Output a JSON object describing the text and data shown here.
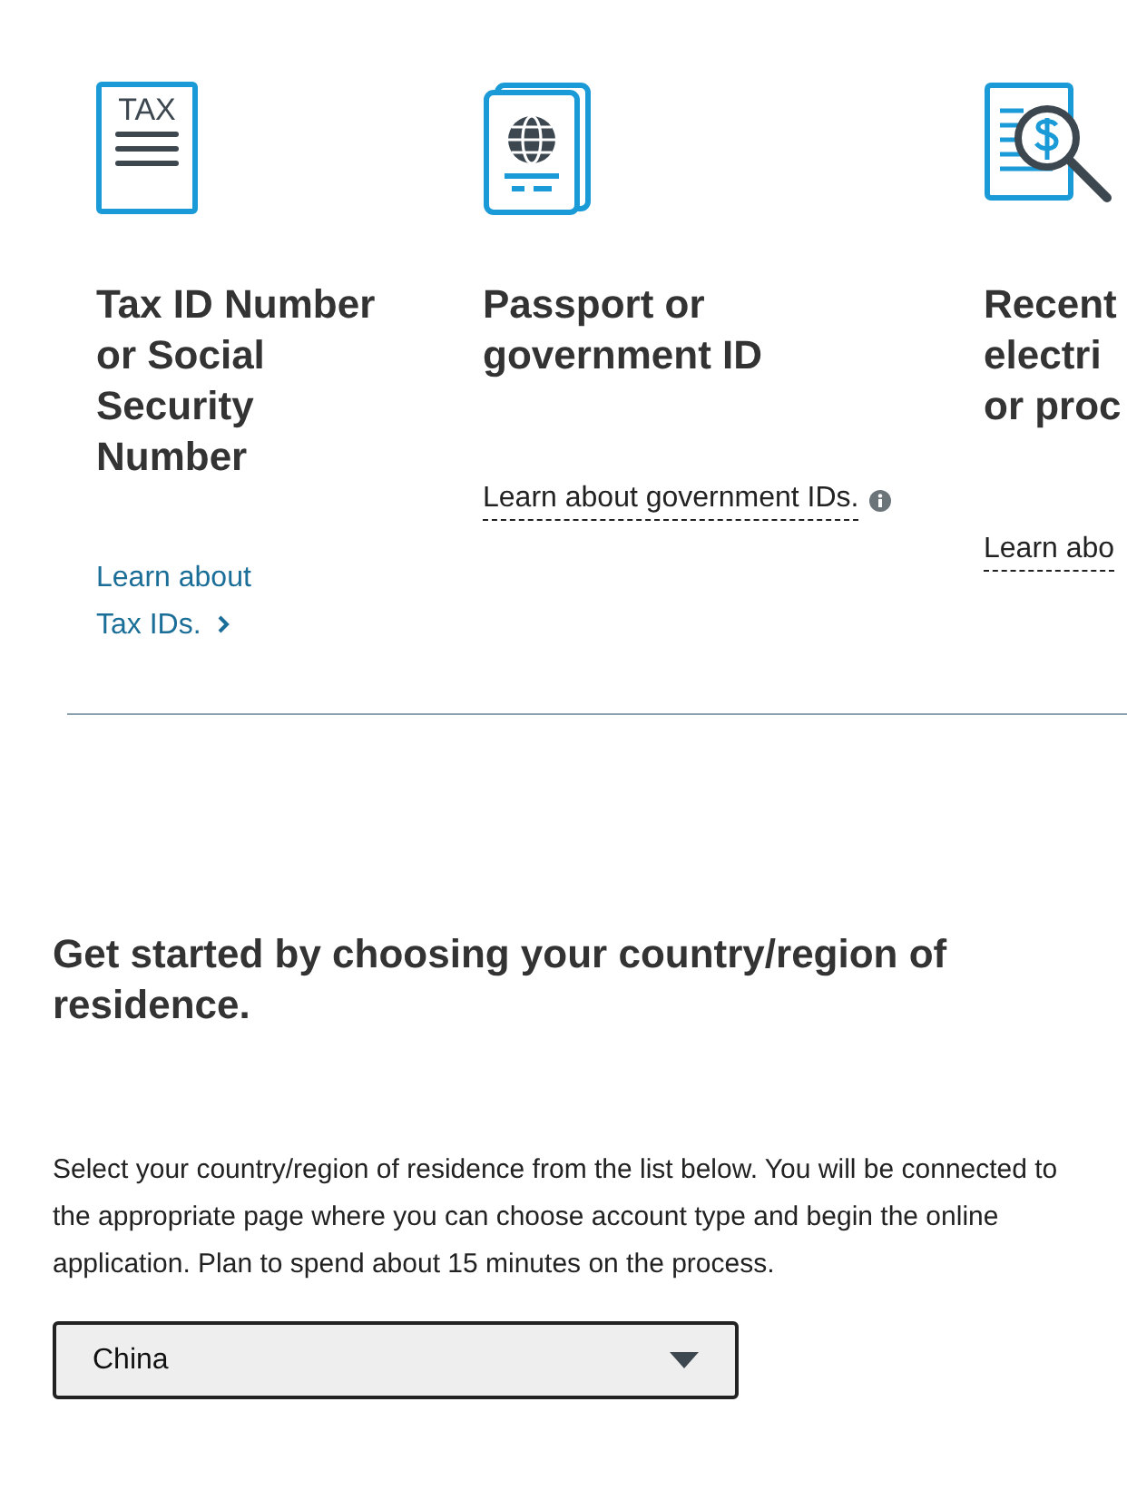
{
  "cards": [
    {
      "kind": "tax",
      "icon_text": "TAX",
      "title_lines": [
        "Tax ID Number",
        "or Social",
        "Security",
        "Number"
      ],
      "link": {
        "kind": "arrow",
        "lines": [
          "Learn about",
          "Tax IDs."
        ]
      }
    },
    {
      "kind": "passport",
      "title_lines": [
        "Passport or",
        "government ID"
      ],
      "link": {
        "kind": "tooltip",
        "lines": [
          "Learn about government IDs."
        ]
      }
    },
    {
      "kind": "bill",
      "title_lines": [
        "Recent",
        "electri",
        "or proc"
      ],
      "link": {
        "kind": "plain",
        "lines": [
          "Learn abo"
        ]
      }
    }
  ],
  "heading": "Get started by choosing your country/region of residence.",
  "intro": "Select your country/region of residence from the list below. You will be connected to the appropriate page where you can choose account type and begin the online application. Plan to spend about 15 minutes on the process.",
  "country_select": {
    "value": "China"
  }
}
